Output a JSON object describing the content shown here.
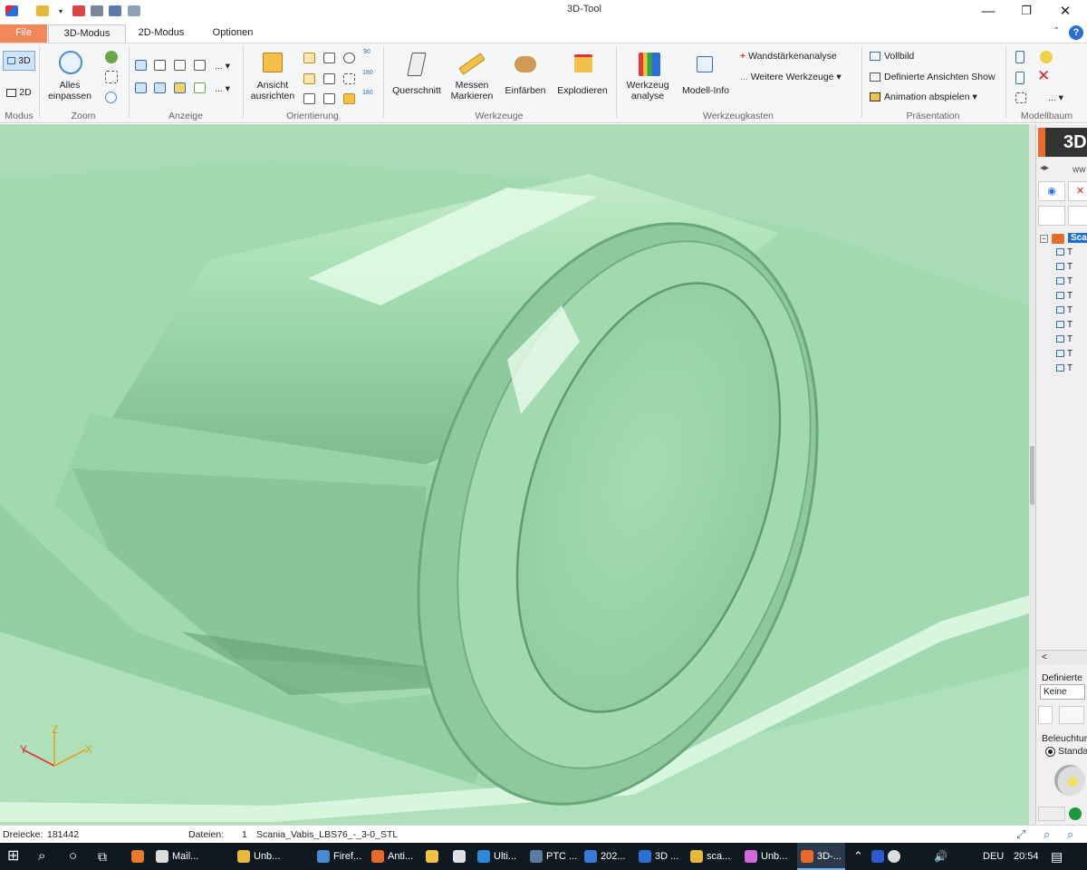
{
  "window": {
    "title": "3D-Tool",
    "minimize": "—",
    "restore": "❐",
    "close": "✕"
  },
  "tabs": {
    "file": "File",
    "mode3d": "3D-Modus",
    "mode2d": "2D-Modus",
    "options": "Optionen"
  },
  "ribbon": {
    "modus": {
      "label": "Modus",
      "btn3d": "3D",
      "btn2d": "2D"
    },
    "zoom": {
      "label": "Zoom",
      "fit": "Alles\neinpassen"
    },
    "anzeige": {
      "label": "Anzeige",
      "more1": "...",
      "more2": "..."
    },
    "orientierung": {
      "label": "Orientierung",
      "align": "Ansicht\nausrichten",
      "deg90": "90",
      "deg180a": "180",
      "deg180b": "180"
    },
    "werkzeuge": {
      "label": "Werkzeuge",
      "querschnitt": "Querschnitt",
      "messen": "Messen\nMarkieren",
      "einfaerben": "Einfärben",
      "explodieren": "Explodieren"
    },
    "werkzeugkasten": {
      "label": "Werkzeugkasten",
      "werkzeuganalyse": "Werkzeug\nanalyse",
      "modellinfo": "Modell-Info",
      "wandstaerke": "Wandstärkenanalyse",
      "weitere": "Weitere Werkzeuge"
    },
    "praesentation": {
      "label": "Präsentation",
      "vollbild": "Vollbild",
      "definierte": "Definierte Ansichten Show",
      "animation": "Animation abspielen"
    },
    "modellbaum": {
      "label": "Modellbaum",
      "more": "..."
    }
  },
  "viewport": {
    "axis_x": "X",
    "axis_y": "Y",
    "axis_z": "Z"
  },
  "rightpanel": {
    "logo": "3D",
    "web": "ww",
    "tree_root": "Sca",
    "tree_children": [
      "T",
      "T",
      "T",
      "T",
      "T",
      "T",
      "T",
      "T",
      "T"
    ],
    "definierte_label": "Definierte",
    "definierte_value": "Keine",
    "beleuchtung_label": "Beleuchtur",
    "standard": "Standa"
  },
  "statusbar": {
    "dreiecke_label": "Dreiecke:",
    "dreiecke_value": "181442",
    "dateien_label": "Dateien:",
    "dateien_count": "1",
    "dateien_name": "Scania_Vabis_LBS76_-_3-0_STL"
  },
  "taskbar": {
    "items": [
      "Mail...",
      "Unb...",
      "Firef...",
      "Anti...",
      "",
      "",
      "Ulti...",
      "PTC ...",
      "202...",
      "3D ...",
      "sca...",
      "Unb...",
      "3D-..."
    ],
    "lang": "DEU",
    "time": "20:54"
  },
  "colors": {
    "file_tab": "#f2885a",
    "viewport": "#9fd8ad",
    "accent_blue": "#1e6fd0"
  }
}
